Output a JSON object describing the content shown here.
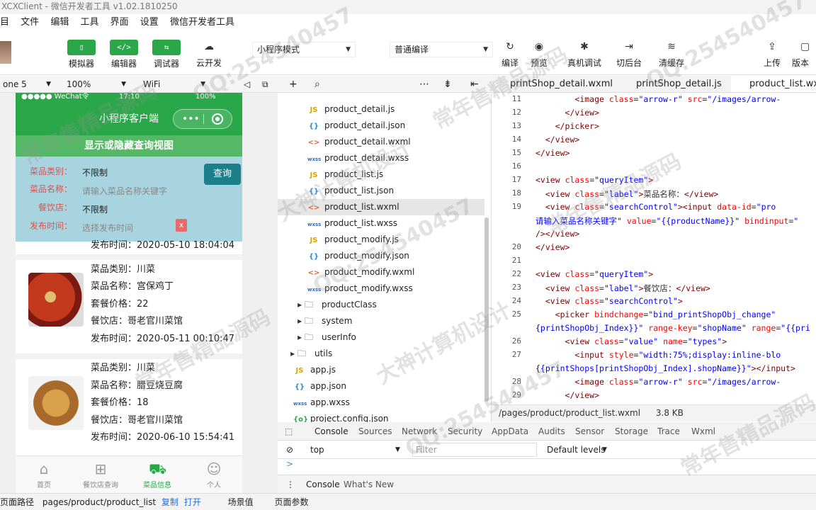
{
  "window": {
    "title": "XCXClient - 微信开发者工具 v1.02.1810250"
  },
  "menu": [
    "目",
    "文件",
    "编辑",
    "工具",
    "界面",
    "设置",
    "微信开发者工具"
  ],
  "toolbar": {
    "left_buttons": [
      {
        "label": "模拟器",
        "icon": "phone-icon"
      },
      {
        "label": "编辑器",
        "icon": "code-icon"
      },
      {
        "label": "调试器",
        "icon": "debug-icon"
      },
      {
        "label": "云开发",
        "icon": "cloud-icon"
      }
    ],
    "mode_select": "小程序模式",
    "compile_select": "普通编译",
    "right_buttons": [
      {
        "label": "编译",
        "icon": "refresh-icon"
      },
      {
        "label": "预览",
        "icon": "eye-icon"
      },
      {
        "label": "真机调试",
        "icon": "bug-icon"
      },
      {
        "label": "切后台",
        "icon": "switch-icon"
      },
      {
        "label": "清缓存",
        "icon": "layers-icon"
      },
      {
        "label": "上传",
        "icon": "upload-icon"
      },
      {
        "label": "版本",
        "icon": "version-icon"
      }
    ]
  },
  "simulator": {
    "device": "one 5",
    "zoom": "100%",
    "network": "WiFi",
    "status": {
      "carrier": "●●●●● WeChat令",
      "time": "17:10",
      "battery": "100%"
    },
    "nav_title": "小程序客户端",
    "capsule_dots": "•••",
    "toggle_label": "显示或隐藏查询视图",
    "query": {
      "rows": [
        {
          "label": "菜品类别：",
          "value": "不限制",
          "placeholder": false
        },
        {
          "label": "菜品名称：",
          "value": "请输入菜品名称关键字",
          "placeholder": true
        },
        {
          "label": "餐饮店：",
          "value": "不限制",
          "placeholder": false
        },
        {
          "label": "发布时间：",
          "value": "选择发布时间",
          "placeholder": true
        }
      ],
      "button": "查询",
      "clear": "x"
    },
    "partial_time": "发布时间：2020-05-10 18:04:04",
    "items": [
      {
        "category": "菜品类别：川菜",
        "name": "菜品名称：宫保鸡丁",
        "price": "套餐价格：22",
        "shop": "餐饮店：哥老官川菜馆",
        "time": "发布时间：2020-05-11 00:10:47"
      },
      {
        "category": "菜品类别：川菜",
        "name": "菜品名称：腊豆烧豆腐",
        "price": "套餐价格：18",
        "shop": "餐饮店：哥老官川菜馆",
        "time": "发布时间：2020-06-10 15:54:41"
      }
    ],
    "tabs": [
      {
        "label": "首页",
        "icon": "home-icon",
        "active": false
      },
      {
        "label": "餐饮店查询",
        "icon": "grid-icon",
        "active": false
      },
      {
        "label": "菜品信息",
        "icon": "cart-icon",
        "active": true
      },
      {
        "label": "个人",
        "icon": "user-icon",
        "active": false
      }
    ]
  },
  "filetree": {
    "files": [
      {
        "name": "product_detail.js",
        "type": "JS"
      },
      {
        "name": "product_detail.json",
        "type": "{}"
      },
      {
        "name": "product_detail.wxml",
        "type": "<>"
      },
      {
        "name": "product_detail.wxss",
        "type": "wxss"
      },
      {
        "name": "product_list.js",
        "type": "JS"
      },
      {
        "name": "product_list.json",
        "type": "{}"
      },
      {
        "name": "product_list.wxml",
        "type": "<>",
        "selected": true
      },
      {
        "name": "product_list.wxss",
        "type": "wxss"
      },
      {
        "name": "product_modify.js",
        "type": "JS"
      },
      {
        "name": "product_modify.json",
        "type": "{}"
      },
      {
        "name": "product_modify.wxml",
        "type": "<>"
      },
      {
        "name": "product_modify.wxss",
        "type": "wxss"
      }
    ],
    "folders": [
      "productClass",
      "system",
      "userInfo"
    ],
    "root_folder": "utils",
    "root_files": [
      {
        "name": "app.js",
        "type": "JS"
      },
      {
        "name": "app.json",
        "type": "{}"
      },
      {
        "name": "app.wxss",
        "type": "wxss"
      },
      {
        "name": "project.config.json",
        "type": "{o}"
      }
    ]
  },
  "editor": {
    "tabs": [
      "printShop_detail.wxml",
      "printShop_detail.js",
      "product_list.wxml"
    ],
    "active_tab": 2,
    "lines": [
      {
        "n": "11",
        "html": "        <span class='tg'>&lt;image</span> <span class='at'>class</span>=<span class='av'>\"arrow-r\"</span> <span class='at'>src</span>=<span class='av'>\"/images/arrow-</span>"
      },
      {
        "n": "12",
        "html": "      <span class='tg'>&lt;/view&gt;</span>"
      },
      {
        "n": "13",
        "html": "    <span class='tg'>&lt;/picker&gt;</span>"
      },
      {
        "n": "14",
        "html": "  <span class='tg'>&lt;/view&gt;</span>"
      },
      {
        "n": "15",
        "html": "<span class='tg'>&lt;/view&gt;</span>"
      },
      {
        "n": "16",
        "html": ""
      },
      {
        "n": "17",
        "html": "<span class='tg'>&lt;view</span> <span class='at'>class</span>=<span class='av'>\"queryItem\"</span><span class='tg'>&gt;</span>"
      },
      {
        "n": "18",
        "html": "  <span class='tg'>&lt;view</span> <span class='at'>class</span>=<span class='av'>\"label\"</span><span class='tg'>&gt;</span>菜品名称：<span class='tg'>&lt;/view&gt;</span>"
      },
      {
        "n": "19",
        "html": "  <span class='tg'>&lt;view</span> <span class='at'>class</span>=<span class='av'>\"searchControl\"</span><span class='tg'>&gt;&lt;input</span> <span class='at'>data-id</span>=<span class='av'>\"pro</span>"
      },
      {
        "n": "",
        "html": "<span class='av'>请输入菜品名称关键字\"</span> <span class='at'>value</span>=<span class='av'>\"{{productName}}\"</span> <span class='at'>bindinput</span>=<span class='av'>\"</span>"
      },
      {
        "n": "",
        "html": "<span class='tg'>/&gt;&lt;/view&gt;</span>"
      },
      {
        "n": "20",
        "html": "<span class='tg'>&lt;/view&gt;</span>"
      },
      {
        "n": "21",
        "html": ""
      },
      {
        "n": "22",
        "html": "<span class='tg'>&lt;view</span> <span class='at'>class</span>=<span class='av'>\"queryItem\"</span><span class='tg'>&gt;</span>"
      },
      {
        "n": "23",
        "html": "  <span class='tg'>&lt;view</span> <span class='at'>class</span>=<span class='av'>\"label\"</span><span class='tg'>&gt;</span>餐饮店：<span class='tg'>&lt;/view&gt;</span>"
      },
      {
        "n": "24",
        "html": "  <span class='tg'>&lt;view</span> <span class='at'>class</span>=<span class='av'>\"searchControl\"</span><span class='tg'>&gt;</span>"
      },
      {
        "n": "25",
        "html": "    <span class='tg'>&lt;picker</span> <span class='at'>bindchange</span>=<span class='av'>\"bind_printShopObj_change\"</span>"
      },
      {
        "n": "",
        "html": "<span class='av'>{printShopObj_Index}}\"</span> <span class='at'>range-key</span>=<span class='av'>\"shopName\"</span> <span class='at'>range</span>=<span class='av'>\"{{pri</span>"
      },
      {
        "n": "26",
        "html": "      <span class='tg'>&lt;view</span> <span class='at'>class</span>=<span class='av'>\"value\"</span> <span class='at'>name</span>=<span class='av'>\"types\"</span><span class='tg'>&gt;</span>"
      },
      {
        "n": "27",
        "html": "        <span class='tg'>&lt;input</span> <span class='at'>style</span>=<span class='av'>\"width:75%;display:inline-blo</span>"
      },
      {
        "n": "",
        "html": "<span class='av'>{{printShops[printShopObj_Index].shopName}}\"</span><span class='tg'>&gt;&lt;/input&gt;</span>"
      },
      {
        "n": "28",
        "html": "        <span class='tg'>&lt;image</span> <span class='at'>class</span>=<span class='av'>\"arrow-r\"</span> <span class='at'>src</span>=<span class='av'>\"/images/arrow-</span>"
      },
      {
        "n": "29",
        "html": "      <span class='tg'>&lt;/view&gt;</span>"
      }
    ],
    "status_path": "/pages/product/product_list.wxml",
    "status_size": "3.8 KB"
  },
  "devtools": {
    "tabs": [
      "Console",
      "Sources",
      "Network",
      "Security",
      "AppData",
      "Audits",
      "Sensor",
      "Storage",
      "Trace",
      "Wxml"
    ],
    "context": "top",
    "filter_placeholder": "Filter",
    "levels": "Default levels",
    "prompt": ">",
    "bottom_tabs": [
      "Console",
      "What's New"
    ]
  },
  "footer": {
    "label": "页面路径",
    "path": "pages/product/product_list",
    "copy": "复制",
    "open": "打开",
    "scene": "场景值",
    "params": "页面参数"
  },
  "watermarks": [
    "常年售精品源码",
    "QQ:254540457",
    "大神计算机设计"
  ],
  "colors": {
    "accent": "#2aa748",
    "query_bg": "#a8d4e0",
    "query_btn": "#1c7f8a"
  }
}
